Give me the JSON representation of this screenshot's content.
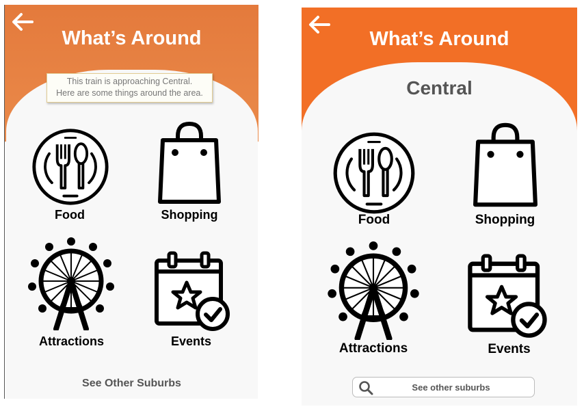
{
  "screens": [
    {
      "id": "before",
      "title": "What’s Around",
      "notice": {
        "line1": "This train is approaching Central.",
        "line2": "Here are some things around the area."
      },
      "categories": {
        "food": "Food",
        "shopping": "Shopping",
        "attractions": "Attractions",
        "events": "Events"
      },
      "see_other": "See Other Suburbs"
    },
    {
      "id": "after",
      "title": "What’s Around",
      "suburb": "Central",
      "categories": {
        "food": "Food",
        "shopping": "Shopping",
        "attractions": "Attractions",
        "events": "Events"
      },
      "search": {
        "placeholder": "See other suburbs"
      }
    }
  ],
  "icons": {
    "back": "back-arrow-icon",
    "food": "plate-cutlery-icon",
    "shopping": "shopping-bag-icon",
    "attractions": "ferris-wheel-icon",
    "events": "calendar-star-check-icon",
    "search": "search-icon"
  },
  "colors": {
    "header_before": "#e47a3c",
    "header_after": "#f26f26",
    "panel": "#f8f8f8",
    "notice_border": "#e2cc92"
  }
}
